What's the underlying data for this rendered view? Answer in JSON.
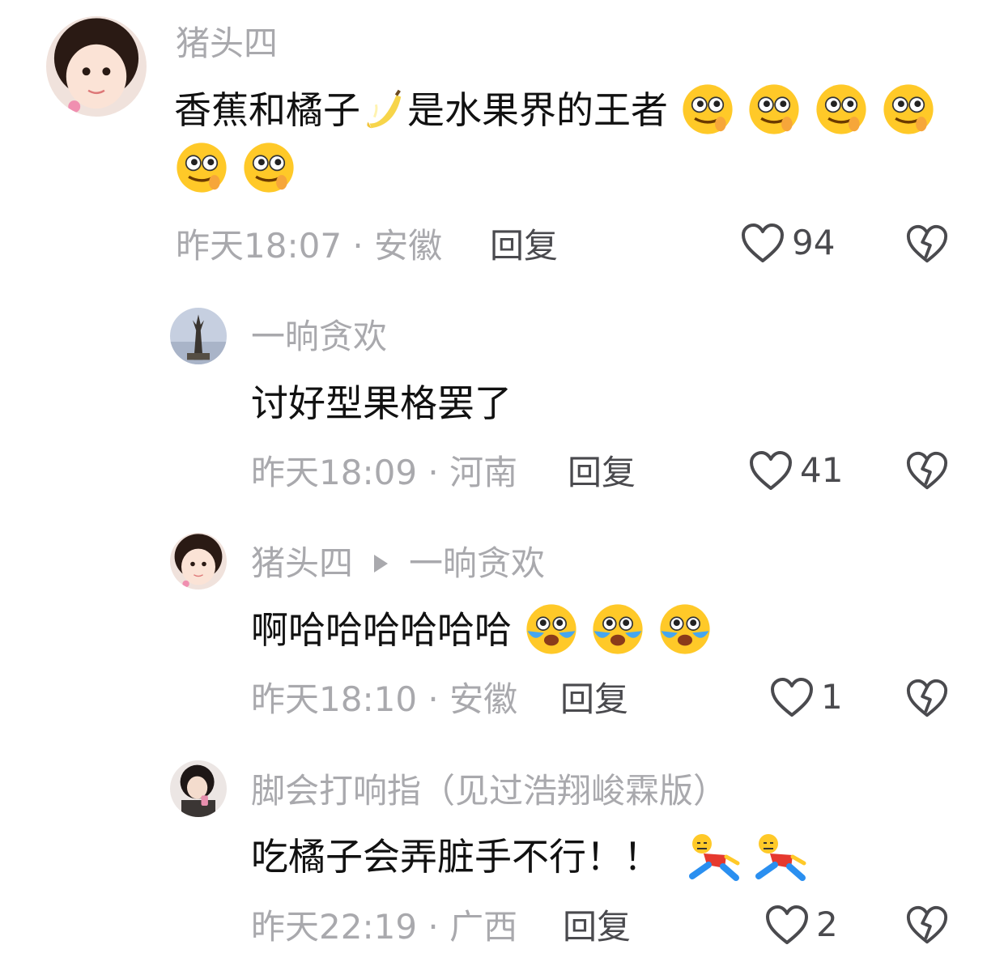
{
  "comments": [
    {
      "user": "猪头四",
      "text_a": "香蕉和橘子",
      "text_b": "是水果界的王者",
      "time": "昨天18:07",
      "region": "安徽",
      "reply": "回复",
      "likes": "94",
      "emoji": [
        "banana-emoji",
        "drool-emoji"
      ]
    },
    {
      "user": "一晌贪欢",
      "text": "讨好型果格罢了",
      "time": "昨天18:09",
      "region": "河南",
      "reply": "回复",
      "likes": "41"
    },
    {
      "user": "猪头四",
      "reply_to": "一晌贪欢",
      "text": "啊哈哈哈哈哈哈",
      "time": "昨天18:10",
      "region": "安徽",
      "reply": "回复",
      "likes": "1",
      "emoji": [
        "crying-laugh-emoji"
      ]
    },
    {
      "user": "脚会打响指（见过浩翔峻霖版）",
      "text": "吃橘子会弄脏手不行！！",
      "time": "昨天22:19",
      "region": "广西",
      "reply": "回复",
      "likes": "2",
      "emoji": [
        "lying-down-emoji"
      ]
    }
  ],
  "separator": " · ",
  "colors": {
    "muted": "#a9a9ad",
    "text": "#111111",
    "action": "#4a4a4e"
  }
}
